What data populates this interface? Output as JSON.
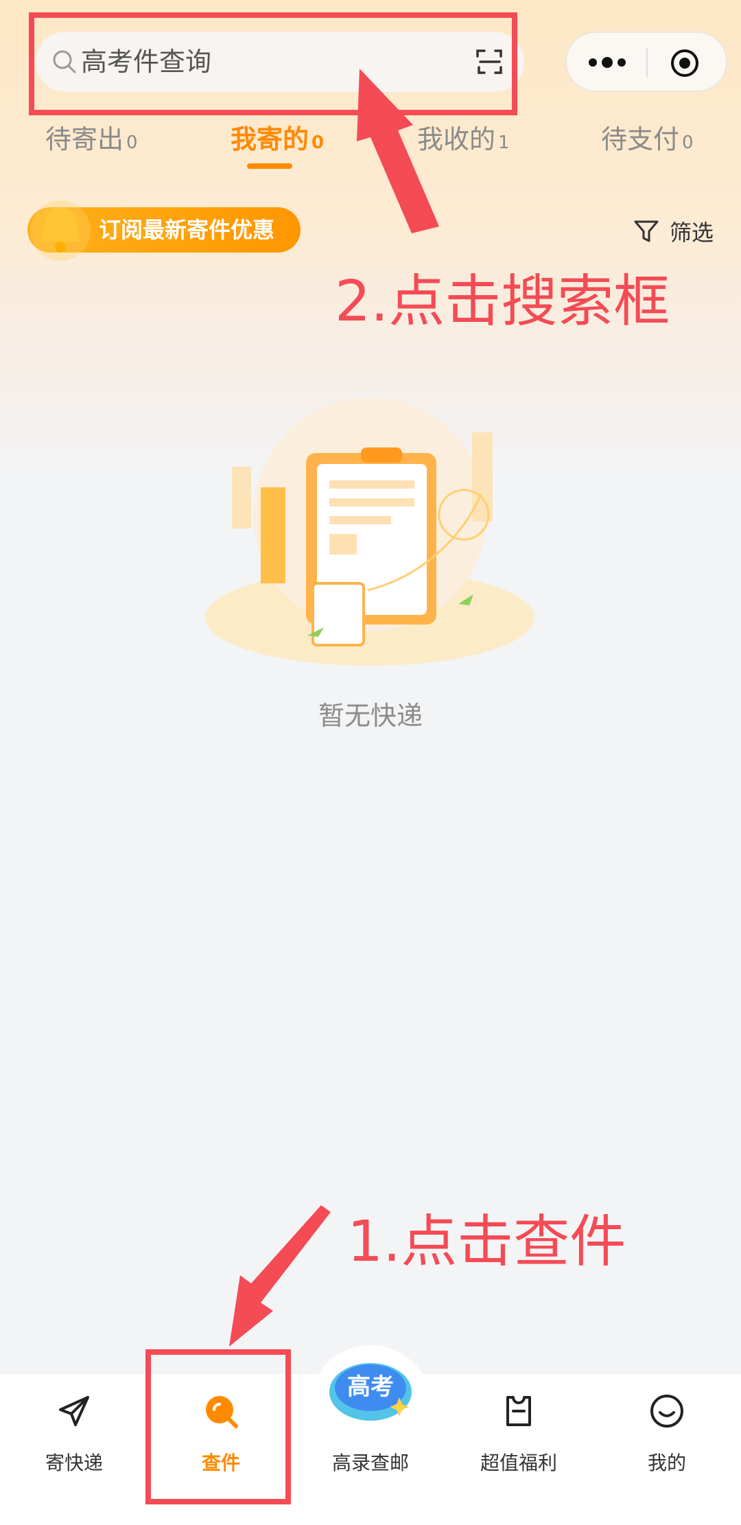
{
  "search": {
    "placeholder": "高考件查询"
  },
  "tabs": [
    {
      "label": "待寄出",
      "count": "0"
    },
    {
      "label": "我寄的",
      "count": "0"
    },
    {
      "label": "我收的",
      "count": "1"
    },
    {
      "label": "待支付",
      "count": "0"
    }
  ],
  "promo": {
    "subscribe_label": "订阅最新寄件优惠",
    "filter_label": "筛选"
  },
  "empty_state": {
    "text": "暂无快递"
  },
  "annotations": {
    "step1": "1.点击查件",
    "step2": "2.点击搜索框"
  },
  "badge": {
    "text": "高考"
  },
  "bottom_nav": [
    {
      "label": "寄快递",
      "icon": "send-icon"
    },
    {
      "label": "查件",
      "icon": "search-package-icon",
      "active": true
    },
    {
      "label": "高录查邮",
      "icon": "gaokao-badge-icon"
    },
    {
      "label": "超值福利",
      "icon": "gift-card-icon"
    },
    {
      "label": "我的",
      "icon": "smiley-icon"
    }
  ],
  "colors": {
    "accent": "#ff8a00",
    "annotation": "#f44b55",
    "background": "#f3f4f6"
  }
}
